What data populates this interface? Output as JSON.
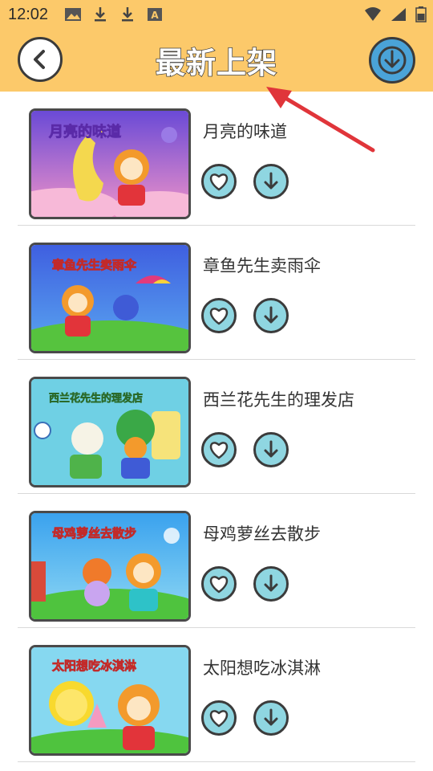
{
  "status_bar": {
    "time": "12:02",
    "left_icons": [
      "image-icon",
      "download-icon",
      "download-icon",
      "text-a-icon"
    ],
    "right_icons": [
      "wifi-icon",
      "signal-icon",
      "battery-icon"
    ]
  },
  "header": {
    "title": "最新上架",
    "back_icon": "chevron-left-icon",
    "download_icon": "download-arrow-icon",
    "background": "#fcc96a"
  },
  "items": [
    {
      "title": "月亮的味道",
      "thumb_caption": "月亮的味道",
      "thumb_bg": "#b14fd8"
    },
    {
      "title": "章鱼先生卖雨伞",
      "thumb_caption": "章鱼先生卖雨伞",
      "thumb_bg": "#4c6ee6"
    },
    {
      "title": "西兰花先生的理发店",
      "thumb_caption": "西兰花先生的理发店",
      "thumb_bg": "#66cfe2"
    },
    {
      "title": "母鸡萝丝去散步",
      "thumb_caption": "母鸡萝丝去散步",
      "thumb_bg": "#45a7ea"
    },
    {
      "title": "太阳想吃冰淇淋",
      "thumb_caption": "太阳想吃冰淇淋",
      "thumb_bg": "#7fd6ee"
    }
  ],
  "annotation": {
    "arrow_color": "#e0353a"
  }
}
